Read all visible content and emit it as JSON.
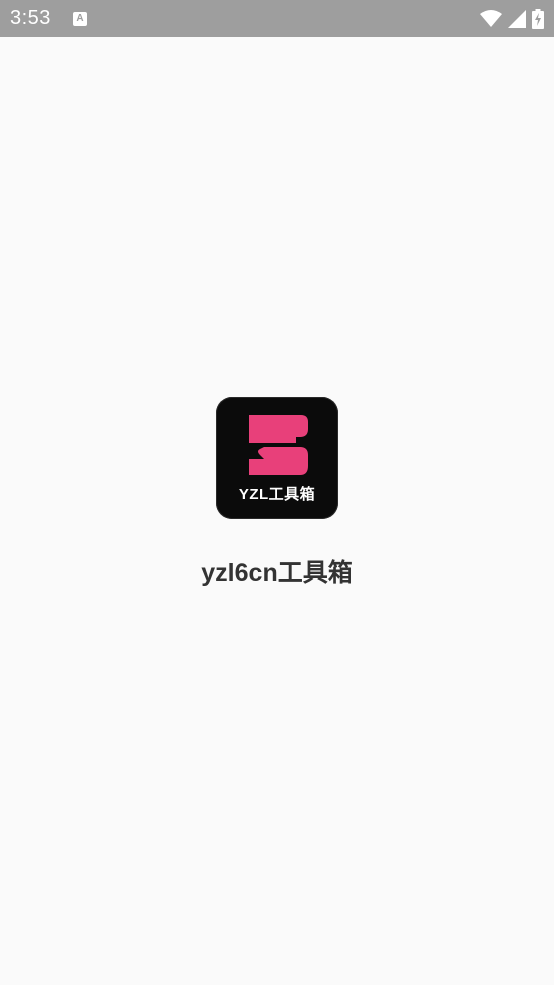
{
  "status_bar": {
    "time": "3:53",
    "notification_icon_glyph": "A",
    "icons": [
      "wifi-icon",
      "cell-signal-icon",
      "battery-charging-icon"
    ]
  },
  "splash": {
    "logo_text": "YZL工具箱",
    "app_name": "yzl6cn工具箱",
    "logo_accent_color": "#e8407a",
    "logo_background_color": "#0b0b0b"
  }
}
